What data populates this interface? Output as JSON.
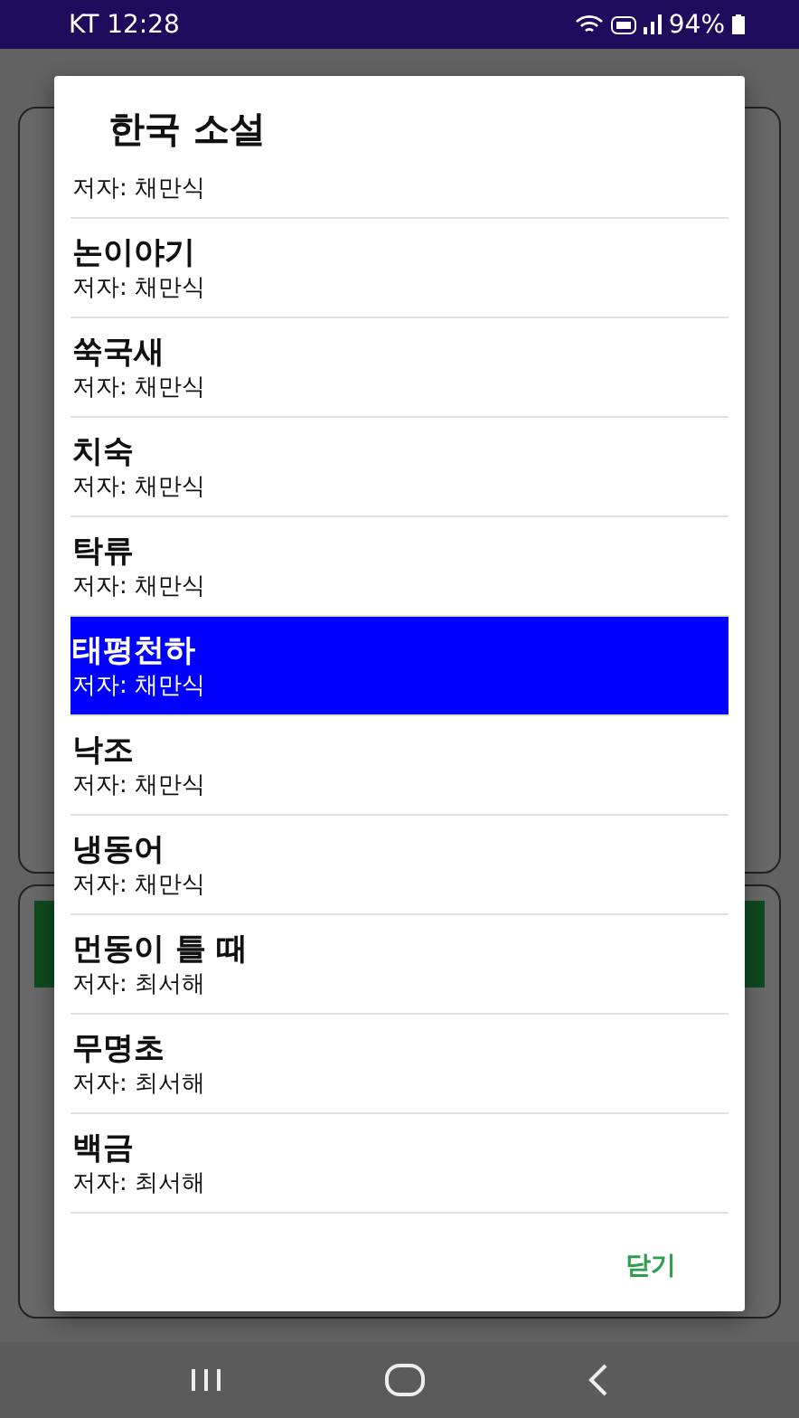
{
  "status_bar": {
    "carrier_time": "KT 12:28",
    "battery": "94%"
  },
  "dialog": {
    "title": "한국 소설",
    "items": [
      {
        "author": "저자: 채만식",
        "selected": false
      },
      {
        "title": "논이야기",
        "author": "저자: 채만식",
        "selected": false
      },
      {
        "title": "쑥국새",
        "author": "저자: 채만식",
        "selected": false
      },
      {
        "title": "치숙",
        "author": "저자: 채만식",
        "selected": false
      },
      {
        "title": "탁류",
        "author": "저자: 채만식",
        "selected": false
      },
      {
        "title": "태평천하",
        "author": "저자: 채만식",
        "selected": true
      },
      {
        "title": "낙조",
        "author": "저자: 채만식",
        "selected": false
      },
      {
        "title": "냉동어",
        "author": "저자: 채만식",
        "selected": false
      },
      {
        "title": "먼동이 틀 때",
        "author": "저자: 최서해",
        "selected": false
      },
      {
        "title": "무명초",
        "author": "저자: 최서해",
        "selected": false
      },
      {
        "title": "백금",
        "author": "저자: 최서해",
        "selected": false
      }
    ],
    "close_button": "닫기"
  }
}
